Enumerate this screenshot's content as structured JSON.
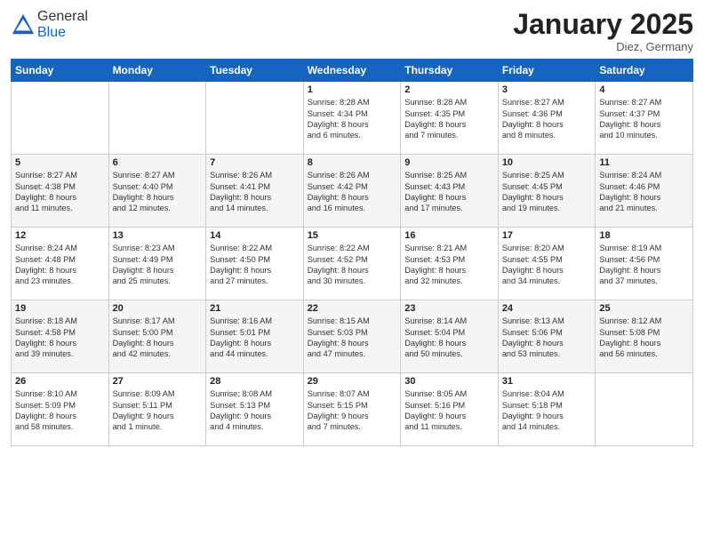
{
  "header": {
    "logo_general": "General",
    "logo_blue": "Blue",
    "month_title": "January 2025",
    "location": "Diez, Germany"
  },
  "weekdays": [
    "Sunday",
    "Monday",
    "Tuesday",
    "Wednesday",
    "Thursday",
    "Friday",
    "Saturday"
  ],
  "weeks": [
    [
      {
        "day": "",
        "info": ""
      },
      {
        "day": "",
        "info": ""
      },
      {
        "day": "",
        "info": ""
      },
      {
        "day": "1",
        "info": "Sunrise: 8:28 AM\nSunset: 4:34 PM\nDaylight: 8 hours\nand 6 minutes."
      },
      {
        "day": "2",
        "info": "Sunrise: 8:28 AM\nSunset: 4:35 PM\nDaylight: 8 hours\nand 7 minutes."
      },
      {
        "day": "3",
        "info": "Sunrise: 8:27 AM\nSunset: 4:36 PM\nDaylight: 8 hours\nand 8 minutes."
      },
      {
        "day": "4",
        "info": "Sunrise: 8:27 AM\nSunset: 4:37 PM\nDaylight: 8 hours\nand 10 minutes."
      }
    ],
    [
      {
        "day": "5",
        "info": "Sunrise: 8:27 AM\nSunset: 4:38 PM\nDaylight: 8 hours\nand 11 minutes."
      },
      {
        "day": "6",
        "info": "Sunrise: 8:27 AM\nSunset: 4:40 PM\nDaylight: 8 hours\nand 12 minutes."
      },
      {
        "day": "7",
        "info": "Sunrise: 8:26 AM\nSunset: 4:41 PM\nDaylight: 8 hours\nand 14 minutes."
      },
      {
        "day": "8",
        "info": "Sunrise: 8:26 AM\nSunset: 4:42 PM\nDaylight: 8 hours\nand 16 minutes."
      },
      {
        "day": "9",
        "info": "Sunrise: 8:25 AM\nSunset: 4:43 PM\nDaylight: 8 hours\nand 17 minutes."
      },
      {
        "day": "10",
        "info": "Sunrise: 8:25 AM\nSunset: 4:45 PM\nDaylight: 8 hours\nand 19 minutes."
      },
      {
        "day": "11",
        "info": "Sunrise: 8:24 AM\nSunset: 4:46 PM\nDaylight: 8 hours\nand 21 minutes."
      }
    ],
    [
      {
        "day": "12",
        "info": "Sunrise: 8:24 AM\nSunset: 4:48 PM\nDaylight: 8 hours\nand 23 minutes."
      },
      {
        "day": "13",
        "info": "Sunrise: 8:23 AM\nSunset: 4:49 PM\nDaylight: 8 hours\nand 25 minutes."
      },
      {
        "day": "14",
        "info": "Sunrise: 8:22 AM\nSunset: 4:50 PM\nDaylight: 8 hours\nand 27 minutes."
      },
      {
        "day": "15",
        "info": "Sunrise: 8:22 AM\nSunset: 4:52 PM\nDaylight: 8 hours\nand 30 minutes."
      },
      {
        "day": "16",
        "info": "Sunrise: 8:21 AM\nSunset: 4:53 PM\nDaylight: 8 hours\nand 32 minutes."
      },
      {
        "day": "17",
        "info": "Sunrise: 8:20 AM\nSunset: 4:55 PM\nDaylight: 8 hours\nand 34 minutes."
      },
      {
        "day": "18",
        "info": "Sunrise: 8:19 AM\nSunset: 4:56 PM\nDaylight: 8 hours\nand 37 minutes."
      }
    ],
    [
      {
        "day": "19",
        "info": "Sunrise: 8:18 AM\nSunset: 4:58 PM\nDaylight: 8 hours\nand 39 minutes."
      },
      {
        "day": "20",
        "info": "Sunrise: 8:17 AM\nSunset: 5:00 PM\nDaylight: 8 hours\nand 42 minutes."
      },
      {
        "day": "21",
        "info": "Sunrise: 8:16 AM\nSunset: 5:01 PM\nDaylight: 8 hours\nand 44 minutes."
      },
      {
        "day": "22",
        "info": "Sunrise: 8:15 AM\nSunset: 5:03 PM\nDaylight: 8 hours\nand 47 minutes."
      },
      {
        "day": "23",
        "info": "Sunrise: 8:14 AM\nSunset: 5:04 PM\nDaylight: 8 hours\nand 50 minutes."
      },
      {
        "day": "24",
        "info": "Sunrise: 8:13 AM\nSunset: 5:06 PM\nDaylight: 8 hours\nand 53 minutes."
      },
      {
        "day": "25",
        "info": "Sunrise: 8:12 AM\nSunset: 5:08 PM\nDaylight: 8 hours\nand 56 minutes."
      }
    ],
    [
      {
        "day": "26",
        "info": "Sunrise: 8:10 AM\nSunset: 5:09 PM\nDaylight: 8 hours\nand 58 minutes."
      },
      {
        "day": "27",
        "info": "Sunrise: 8:09 AM\nSunset: 5:11 PM\nDaylight: 9 hours\nand 1 minute."
      },
      {
        "day": "28",
        "info": "Sunrise: 8:08 AM\nSunset: 5:13 PM\nDaylight: 9 hours\nand 4 minutes."
      },
      {
        "day": "29",
        "info": "Sunrise: 8:07 AM\nSunset: 5:15 PM\nDaylight: 9 hours\nand 7 minutes."
      },
      {
        "day": "30",
        "info": "Sunrise: 8:05 AM\nSunset: 5:16 PM\nDaylight: 9 hours\nand 11 minutes."
      },
      {
        "day": "31",
        "info": "Sunrise: 8:04 AM\nSunset: 5:18 PM\nDaylight: 9 hours\nand 14 minutes."
      },
      {
        "day": "",
        "info": ""
      }
    ]
  ]
}
